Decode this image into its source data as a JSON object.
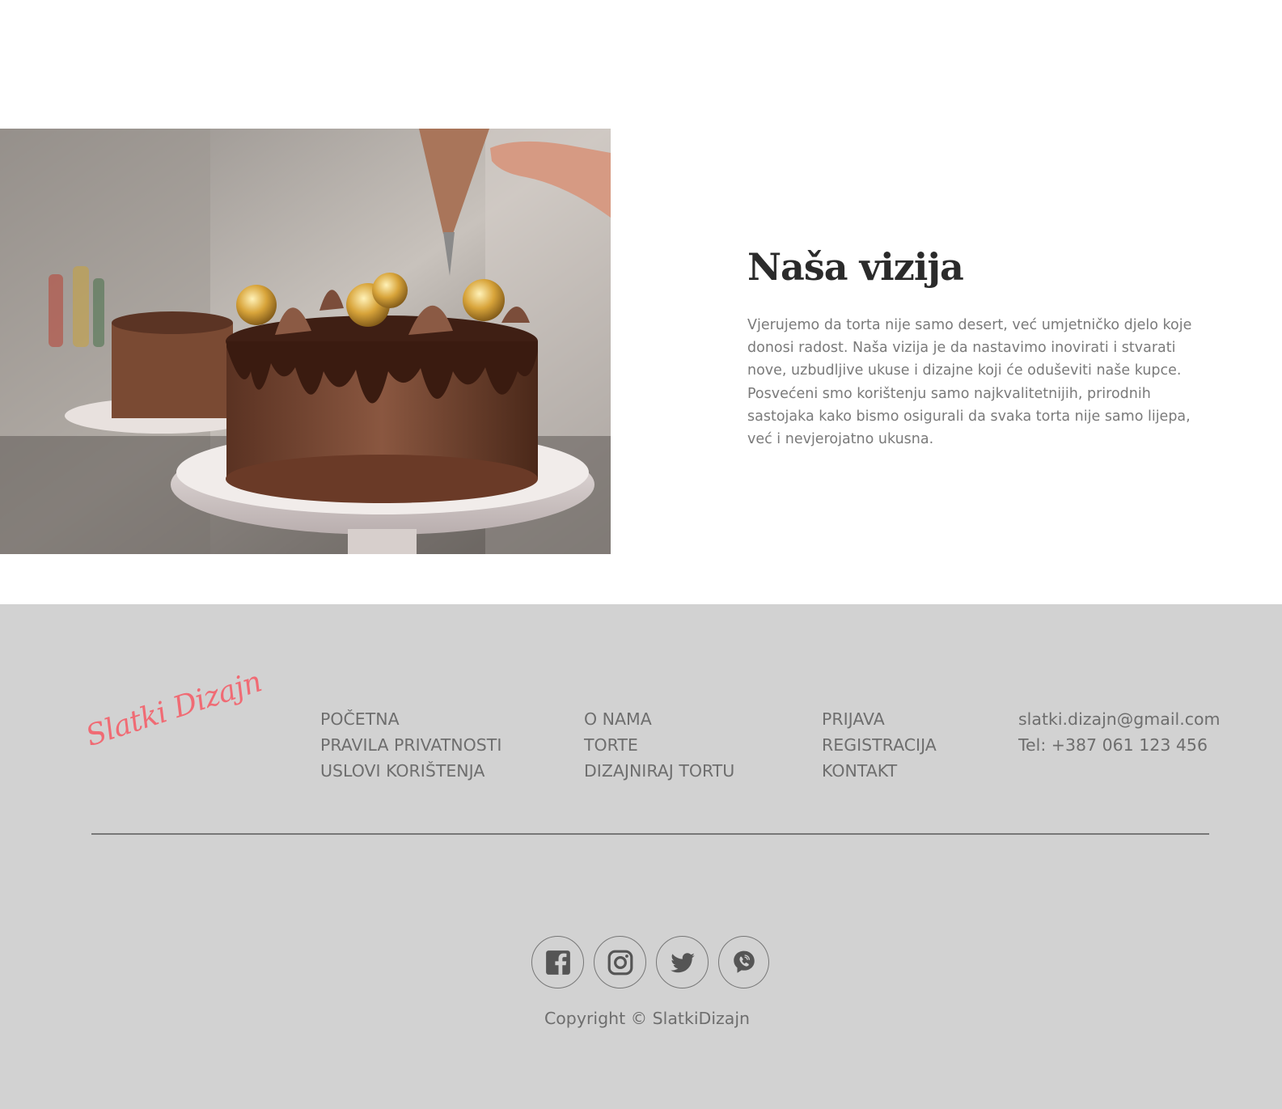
{
  "vision": {
    "title": "Naša vizija",
    "body": "Vjerujemo da torta nije samo desert, već umjetničko djelo koje donosi radost. Naša vizija je da nastavimo inovirati i stvarati nove, uzbudljive ukuse i dizajne koji će oduševiti naše kupce. Posvećeni smo korištenju samo najkvalitetnijih, prirodnih sastojaka kako bismo osigurali da svaka torta nije samo lijepa, već i nevjerojatno ukusna."
  },
  "footer": {
    "logo": "Slatki Dizajn",
    "nav_columns": [
      [
        "POČETNA",
        "PRAVILA PRIVATNOSTI",
        "USLOVI KORIŠTENJA"
      ],
      [
        "O NAMA",
        "TORTE",
        "DIZAJNIRAJ TORTU"
      ],
      [
        "PRIJAVA",
        "REGISTRACIJA",
        "KONTAKT"
      ]
    ],
    "contact": {
      "email": "slatki.dizajn@gmail.com",
      "phone": "Tel: +387 061 123 456"
    },
    "socials": [
      "facebook-icon",
      "instagram-icon",
      "twitter-icon",
      "viber-icon"
    ],
    "copyright": "Copyright © SlatkiDizajn"
  },
  "colors": {
    "footer_bg": "#d2d2d2",
    "logo": "#f06b74",
    "title": "#2b2b2b",
    "text": "#7a7a7a",
    "link": "#6e6e6e"
  }
}
